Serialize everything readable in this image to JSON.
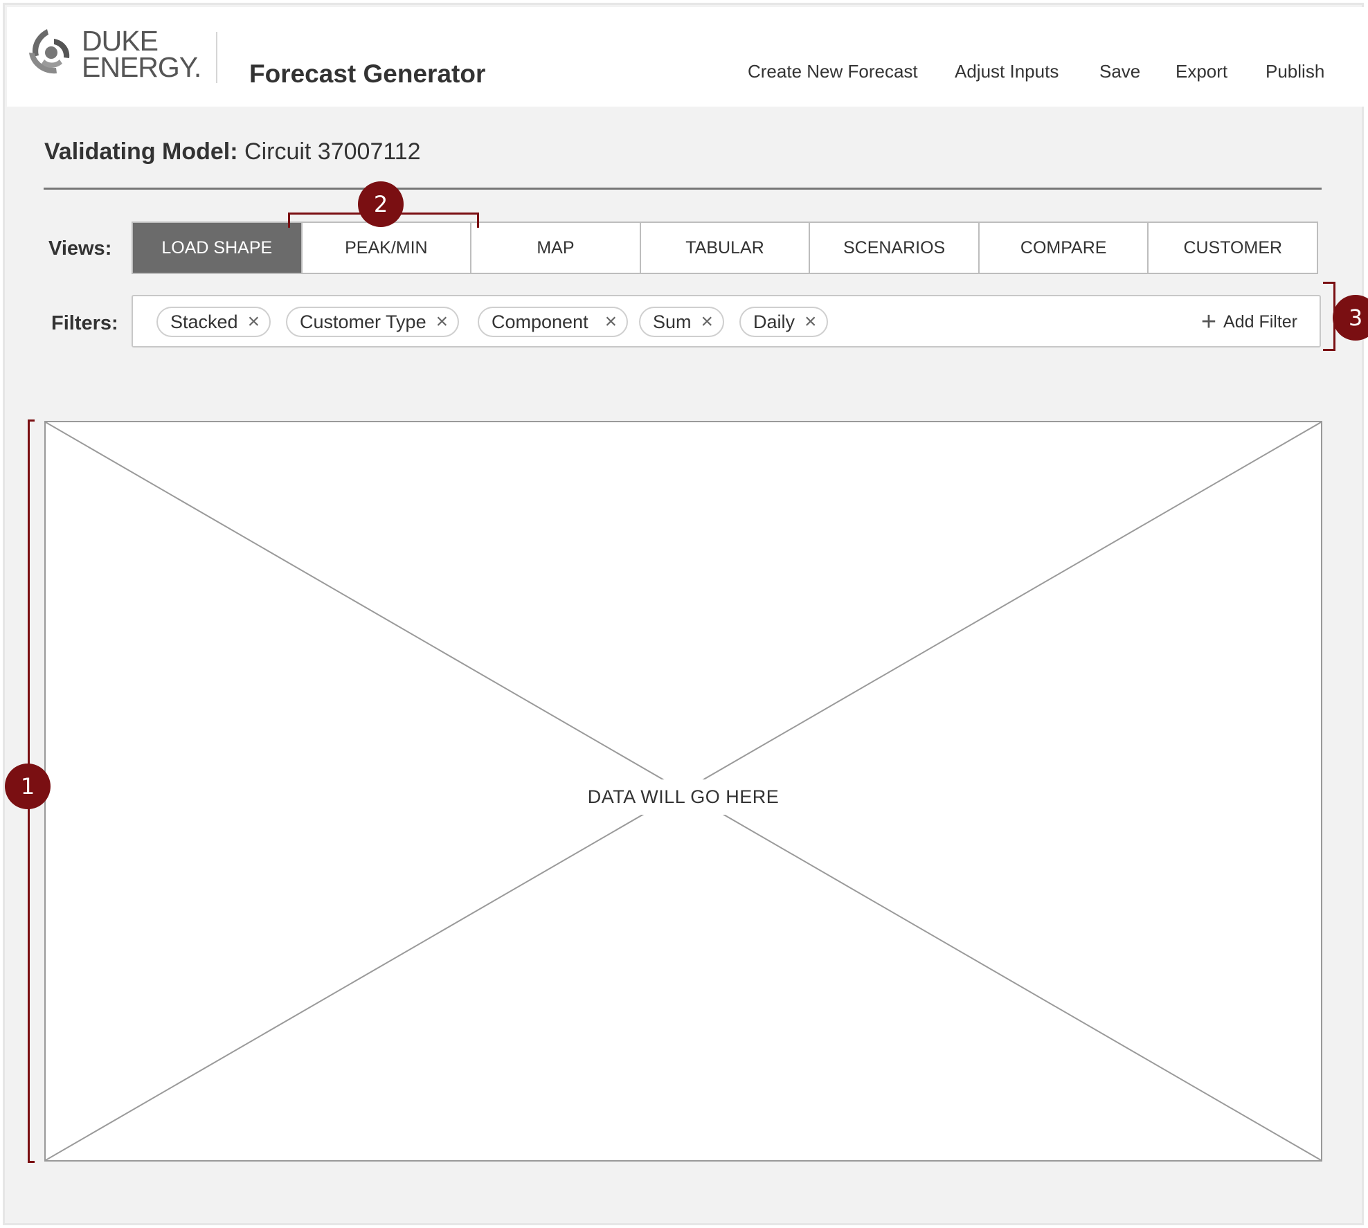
{
  "header": {
    "brand_line1": "DUKE",
    "brand_line2": "ENERGY.",
    "app_title": "Forecast Generator",
    "nav": [
      {
        "label": "Create New Forecast"
      },
      {
        "label": "Adjust Inputs"
      },
      {
        "label": "Save"
      },
      {
        "label": "Export"
      },
      {
        "label": "Publish"
      }
    ]
  },
  "model": {
    "label": "Validating Model:",
    "value": " Circuit 37007112"
  },
  "views": {
    "label": "Views:",
    "tabs": [
      {
        "label": "LOAD SHAPE",
        "active": true
      },
      {
        "label": "PEAK/MIN"
      },
      {
        "label": "MAP"
      },
      {
        "label": "TABULAR"
      },
      {
        "label": "SCENARIOS"
      },
      {
        "label": "COMPARE"
      },
      {
        "label": "CUSTOMER"
      }
    ]
  },
  "filters": {
    "label": "Filters:",
    "chips": [
      {
        "label": "Stacked"
      },
      {
        "label": "Customer Type"
      },
      {
        "label": "Component"
      },
      {
        "label": "Sum"
      },
      {
        "label": "Daily"
      }
    ],
    "add_label": "Add Filter",
    "remove_glyph": "×",
    "add_glyph": "+"
  },
  "placeholder": {
    "label": "DATA WILL GO HERE"
  },
  "annotations": {
    "marker1": "1",
    "marker2": "2",
    "marker3": "3"
  },
  "colors": {
    "annotation": "#7a0f12",
    "active_tab": "#6b6b6b",
    "background": "#f2f2f2"
  }
}
